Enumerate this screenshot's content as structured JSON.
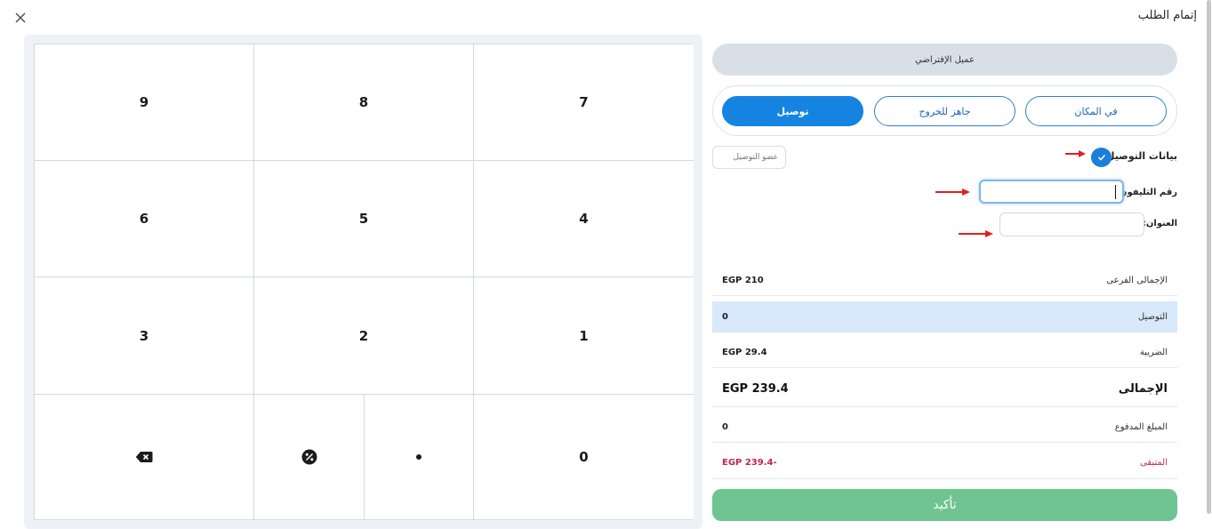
{
  "dialog": {
    "title": "إتمام الطلب"
  },
  "keypad": {
    "keys": [
      "9",
      "8",
      "7",
      "6",
      "5",
      "4",
      "3",
      "2",
      "1",
      "0"
    ],
    "icons": {
      "backspace": "backspace-icon",
      "discount": "discount-icon",
      "dot": "decimal-point-icon"
    }
  },
  "customer": {
    "label": "عميل الإفتراضي"
  },
  "order_types": [
    {
      "label": "في المكان",
      "active": false
    },
    {
      "label": "جاهز للخروج",
      "active": false
    },
    {
      "label": "توصيل",
      "active": true
    }
  ],
  "delivery": {
    "title": "بيانات التوصيل",
    "checked": true,
    "driver_placeholder": "عضو التوصيل",
    "phone_label": "رقم التليفون:",
    "phone_value": "",
    "address_label": "العنوان:",
    "address_value": ""
  },
  "summary": [
    {
      "label": "الإجمالى الفرعى",
      "value": "EGP 210"
    },
    {
      "label": "التوصيل",
      "value": "0"
    },
    {
      "label": "الضريبة",
      "value": "EGP 29.4"
    },
    {
      "label": "الإجمالى",
      "value": "EGP 239.4"
    },
    {
      "label": "المبلغ المدفوع",
      "value": "0"
    },
    {
      "label": "المتبقى",
      "value": "EGP 239.4-"
    }
  ],
  "confirm_label": "تأكيد",
  "colors": {
    "accent": "#1484e0",
    "confirm": "#6fc492",
    "highlight_row": "#d7e9fb",
    "remaining": "#c0264c",
    "annotation_arrow": "#e02020"
  }
}
